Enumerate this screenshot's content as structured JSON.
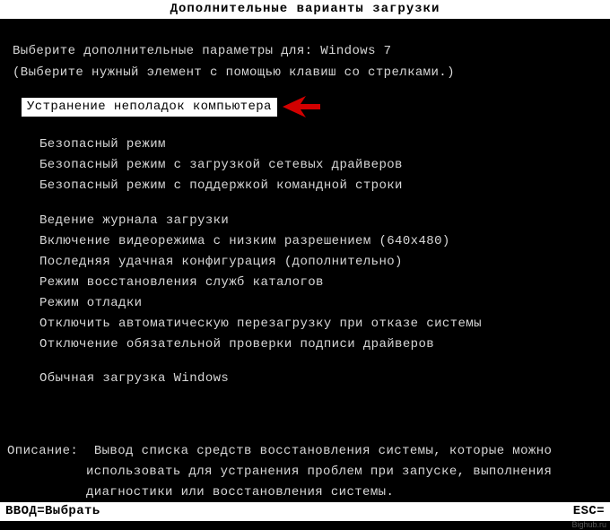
{
  "header": "Дополнительные варианты загрузки",
  "intro": {
    "line1_left": "Выберите дополнительные параметры для: ",
    "line1_os": "Windows 7",
    "line2": "(Выберите нужный элемент с помощью клавиш со стрелками.)"
  },
  "selected": "Устранение неполадок компьютера",
  "group1": [
    "Безопасный режим",
    "Безопасный режим с загрузкой сетевых драйверов",
    "Безопасный режим с поддержкой командной строки"
  ],
  "group2": [
    "Ведение журнала загрузки",
    "Включение видеорежима с низким разрешением (640x480)",
    "Последняя удачная конфигурация (дополнительно)",
    "Режим восстановления служб каталогов",
    "Режим отладки",
    "Отключить автоматическую перезагрузку при отказе системы",
    "Отключение обязательной проверки подписи драйверов"
  ],
  "normal": "Обычная загрузка Windows",
  "description": {
    "label": "Описание:",
    "l1": "Вывод списка средств восстановления системы, которые можно",
    "l2": "использовать для устранения проблем при запуске, выполнения",
    "l3": "диагностики или восстановления системы."
  },
  "footer": {
    "left": "ВВОД=Выбрать",
    "right": "ESC="
  },
  "watermark": "Bighub.ru"
}
